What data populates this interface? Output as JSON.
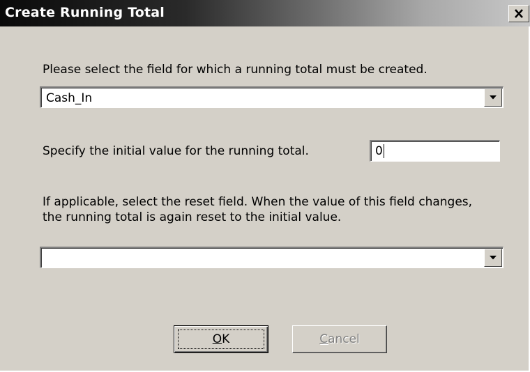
{
  "window": {
    "title": "Create Running Total",
    "close_glyph": "✕"
  },
  "field_section": {
    "label": "Please select the field for which a running total must be created.",
    "selected_value": "Cash_In"
  },
  "initial_value_section": {
    "label": "Specify the initial value for the running total.",
    "value": "0"
  },
  "reset_section": {
    "label_line1": "If applicable, select the reset field. When the value of this field changes,",
    "label_line2": "the running total is again reset to the initial value.",
    "selected_value": ""
  },
  "buttons": {
    "ok": {
      "mnemonic": "O",
      "rest": "K"
    },
    "cancel": {
      "mnemonic": "C",
      "rest": "ancel",
      "enabled": false
    }
  },
  "icons": {
    "close": "close-icon",
    "dropdown": "chevron-down-icon"
  },
  "colors": {
    "dialog_bg": "#d4d0c8",
    "title_text": "#ffffff",
    "disabled_text": "#808080"
  }
}
